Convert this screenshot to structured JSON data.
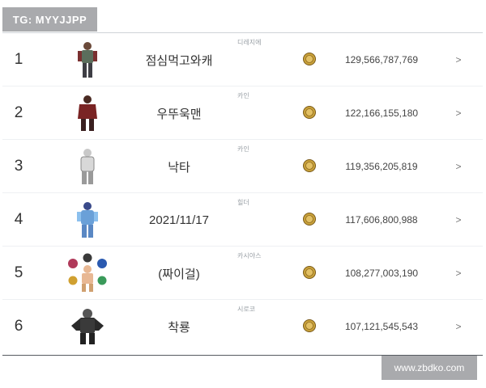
{
  "header": {
    "badge": "TG: MYYJJPP"
  },
  "coin_icon": "gold-coin-icon",
  "chevron_glyph": ">",
  "rows": [
    {
      "rank": "1",
      "name": "점심먹고와캐",
      "server": "디레지에",
      "gold": "129,566,787,769",
      "avatar_icon": "character-avatar-icon"
    },
    {
      "rank": "2",
      "name": "우뚜욱맨",
      "server": "카인",
      "gold": "122,166,155,180",
      "avatar_icon": "character-avatar-icon"
    },
    {
      "rank": "3",
      "name": "낙타",
      "server": "카인",
      "gold": "119,356,205,819",
      "avatar_icon": "character-avatar-icon"
    },
    {
      "rank": "4",
      "name": "2021/11/17",
      "server": "힐더",
      "gold": "117,606,800,988",
      "avatar_icon": "character-avatar-icon"
    },
    {
      "rank": "5",
      "name": "(짜이걸)",
      "server": "카시야스",
      "gold": "108,277,003,190",
      "avatar_icon": "character-avatar-icon"
    },
    {
      "rank": "6",
      "name": "착룡",
      "server": "시로코",
      "gold": "107,121,545,543",
      "avatar_icon": "character-avatar-icon"
    }
  ],
  "watermark": "www.zbdko.com",
  "colors": {
    "badge_bg": "#a9aaad",
    "text": "#333333",
    "coin": "#c9a23a"
  }
}
